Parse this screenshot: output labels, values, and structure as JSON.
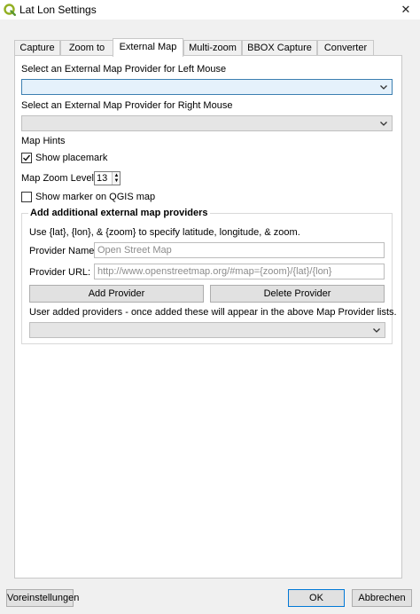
{
  "window": {
    "title": "Lat Lon Settings",
    "close_glyph": "✕"
  },
  "tabs": [
    {
      "label": "Capture",
      "active": false
    },
    {
      "label": "Zoom to",
      "active": false
    },
    {
      "label": "External Map",
      "active": true
    },
    {
      "label": "Multi-zoom",
      "active": false
    },
    {
      "label": "BBOX Capture",
      "active": false
    },
    {
      "label": "Converter",
      "active": false
    }
  ],
  "external_map": {
    "left_mouse_label": "Select an External Map Provider for Left Mouse",
    "left_mouse_value": "",
    "right_mouse_label": "Select an External Map Provider for Right Mouse",
    "right_mouse_value": "",
    "map_hints_label": "Map Hints",
    "show_placemark": {
      "label": "Show placemark",
      "checked": true
    },
    "zoom_level_label": "Map Zoom Level:",
    "zoom_level_value": "13",
    "show_marker": {
      "label": "Show marker on QGIS map",
      "checked": false
    }
  },
  "providers_group": {
    "title": "Add additional external map providers",
    "hint": "Use {lat},  {lon}, & {zoom} to specify latitude, longitude, & zoom.",
    "name_label": "Provider Name:",
    "name_placeholder": "Open Street Map",
    "url_label": "Provider URL:",
    "url_placeholder": "http://www.openstreetmap.org/#map={zoom}/{lat}/{lon}",
    "add_button": "Add Provider",
    "delete_button": "Delete Provider",
    "user_added_label": "User added providers - once added these will appear in the above Map Provider lists.",
    "user_added_value": ""
  },
  "footer": {
    "defaults_button": "Voreinstellungen",
    "ok_button": "OK",
    "cancel_button": "Abbrechen"
  },
  "colors": {
    "qgis_green": "#93b023",
    "focus_blue": "#3c7fb1",
    "primary_border": "#0078d7"
  },
  "icons": {
    "app": "qgis-logo-icon",
    "close": "close-icon",
    "dropdown": "chevron-down-icon",
    "check": "checkmark-icon",
    "spin_up": "spin-up-icon",
    "spin_down": "spin-down-icon"
  }
}
